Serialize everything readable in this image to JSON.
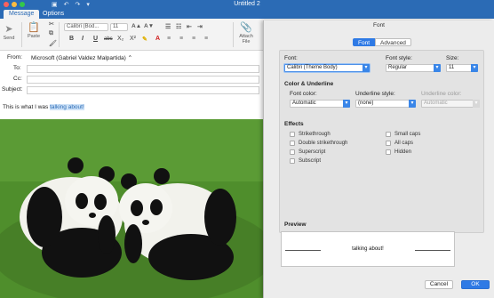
{
  "window": {
    "title": "Untitled 2"
  },
  "tabs": [
    {
      "label": "Message"
    },
    {
      "label": "Options"
    }
  ],
  "ribbon": {
    "send_label": "Send",
    "paste_label": "Paste",
    "font_name": "Calibri (Bod...",
    "font_size": "11",
    "bold": "B",
    "italic": "I",
    "underline": "U",
    "strike": "abc",
    "subscript": "X₂",
    "superscript": "X²",
    "attach_label": "Attach File"
  },
  "headers": {
    "from_label": "From:",
    "from_value": "Microsoft (Gabriel Valdez Malpartida) ⌃",
    "to_label": "To:",
    "cc_label": "Cc:",
    "subject_label": "Subject:"
  },
  "body": {
    "prefix": "This is what I was ",
    "highlight": "talking about!"
  },
  "dialog": {
    "title": "Font",
    "tab_font": "Font",
    "tab_advanced": "Advanced",
    "font_label": "Font:",
    "font_value": "Calibri (Theme Body)",
    "style_label": "Font style:",
    "style_value": "Regular",
    "size_label": "Size:",
    "size_value": "11",
    "color_section": "Color & Underline",
    "font_color_label": "Font color:",
    "font_color_value": "Automatic",
    "underline_style_label": "Underline style:",
    "underline_style_value": "(none)",
    "underline_color_label": "Underline color:",
    "underline_color_value": "Automatic",
    "effects_label": "Effects",
    "effects": [
      "Strikethrough",
      "Double strikethrough",
      "Superscript",
      "Subscript",
      "Small caps",
      "All caps",
      "Hidden"
    ],
    "preview_label": "Preview",
    "preview_text": "talking about!",
    "cancel_label": "Cancel",
    "ok_label": "OK"
  },
  "colors": {
    "accent": "#2b6bb5",
    "button_blue": "#2f7ae5",
    "highlight": "#cfe3f8"
  }
}
